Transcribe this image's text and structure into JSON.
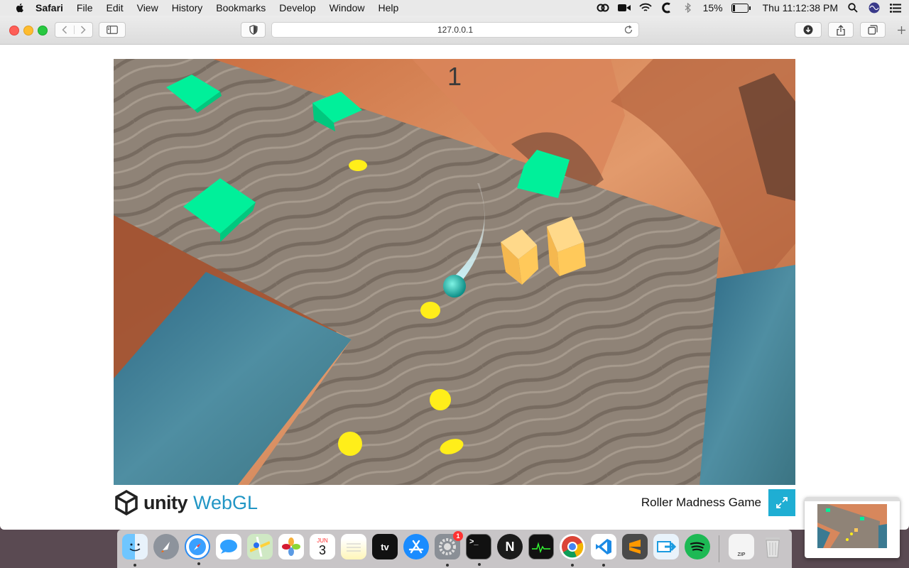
{
  "menubar": {
    "app": "Safari",
    "items": [
      "File",
      "Edit",
      "View",
      "History",
      "Bookmarks",
      "Develop",
      "Window",
      "Help"
    ],
    "battery": "15%",
    "battery_level": 0.15,
    "clock": "Thu 11:12:38 PM"
  },
  "browser": {
    "url": "127.0.0.1"
  },
  "game": {
    "score": "1",
    "title": "Roller Madness Game",
    "engine_name": "unity",
    "engine_target": "WebGL"
  },
  "dock": {
    "calendar_month": "JUN",
    "calendar_day": "3",
    "appletv_label": "tv",
    "terminal_prompt": ">_",
    "notion_letter": "N",
    "zip_label": "ZIP",
    "notification_badge": "1"
  },
  "colors": {
    "accent": "#1faed3",
    "webgl_blue": "#2196c5",
    "pickup_green": "#00f09a",
    "coin_yellow": "#ffee1a",
    "crate_orange": "#ffc95a"
  }
}
